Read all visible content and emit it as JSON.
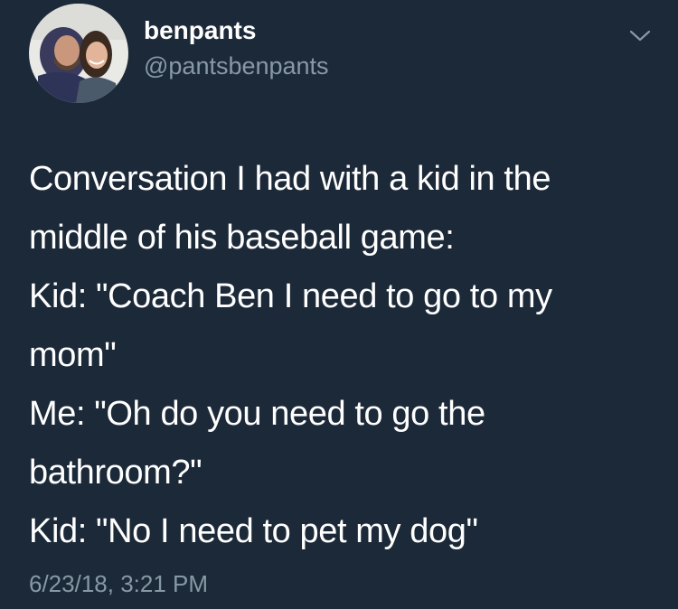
{
  "user": {
    "display_name": "benpants",
    "handle": "@pantsbenpants",
    "avatar_icon": "profile-photo-couple"
  },
  "tweet": {
    "lines": [
      "Conversation I had with a kid in the",
      "middle of his baseball game:",
      "Kid: \"Coach Ben I need to go to my",
      "mom\"",
      "Me: \"Oh do you need to go the",
      "bathroom?\"",
      "Kid: \"No I need to pet my dog\""
    ],
    "timestamp": "6/23/18, 3:21 PM"
  },
  "menu": {
    "icon": "chevron-down-icon"
  },
  "colors": {
    "background": "#1c2938",
    "primary_text": "#ffffff",
    "secondary_text": "#8899a6"
  }
}
